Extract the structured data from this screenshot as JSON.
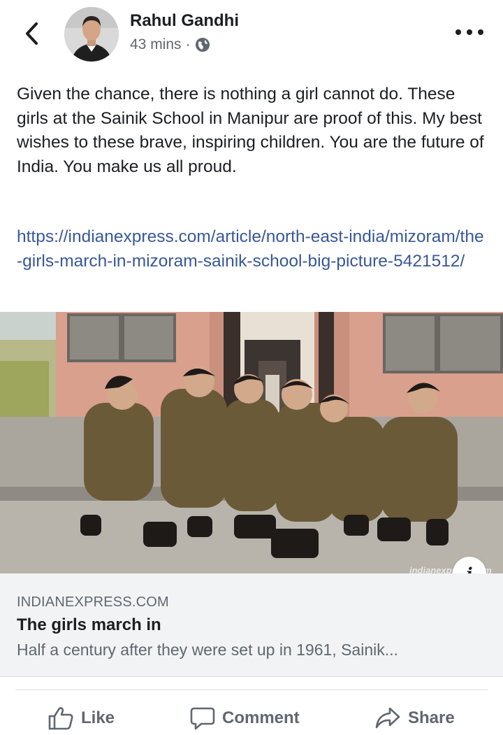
{
  "header": {
    "back_icon": "chevron-left-icon",
    "author_name": "Rahul Gandhi",
    "timestamp": "43 mins",
    "separator": "·",
    "privacy_icon": "globe-icon",
    "more_icon": "more-horizontal-icon"
  },
  "post": {
    "text": "Given the chance, there is nothing a girl cannot do. These girls at the Sainik School in Manipur are proof of this. My best wishes to these brave, inspiring children. You are the future of India. You make us all proud.",
    "link": "https://indianexpress.com/article/north-east-india/mizoram/the-girls-march-in-mizoram-sainik-school-big-picture-5421512/"
  },
  "photo": {
    "watermark": "indianexpress.com",
    "info_label": "i"
  },
  "link_card": {
    "domain": "INDIANEXPRESS.COM",
    "title": "The girls march in",
    "description": "Half a century after they were set up in 1961, Sainik..."
  },
  "actions": {
    "like": "Like",
    "comment": "Comment",
    "share": "Share"
  },
  "colors": {
    "link": "#385898",
    "text": "#1c1e21",
    "secondary": "#606770",
    "card_bg": "#f2f3f5"
  }
}
